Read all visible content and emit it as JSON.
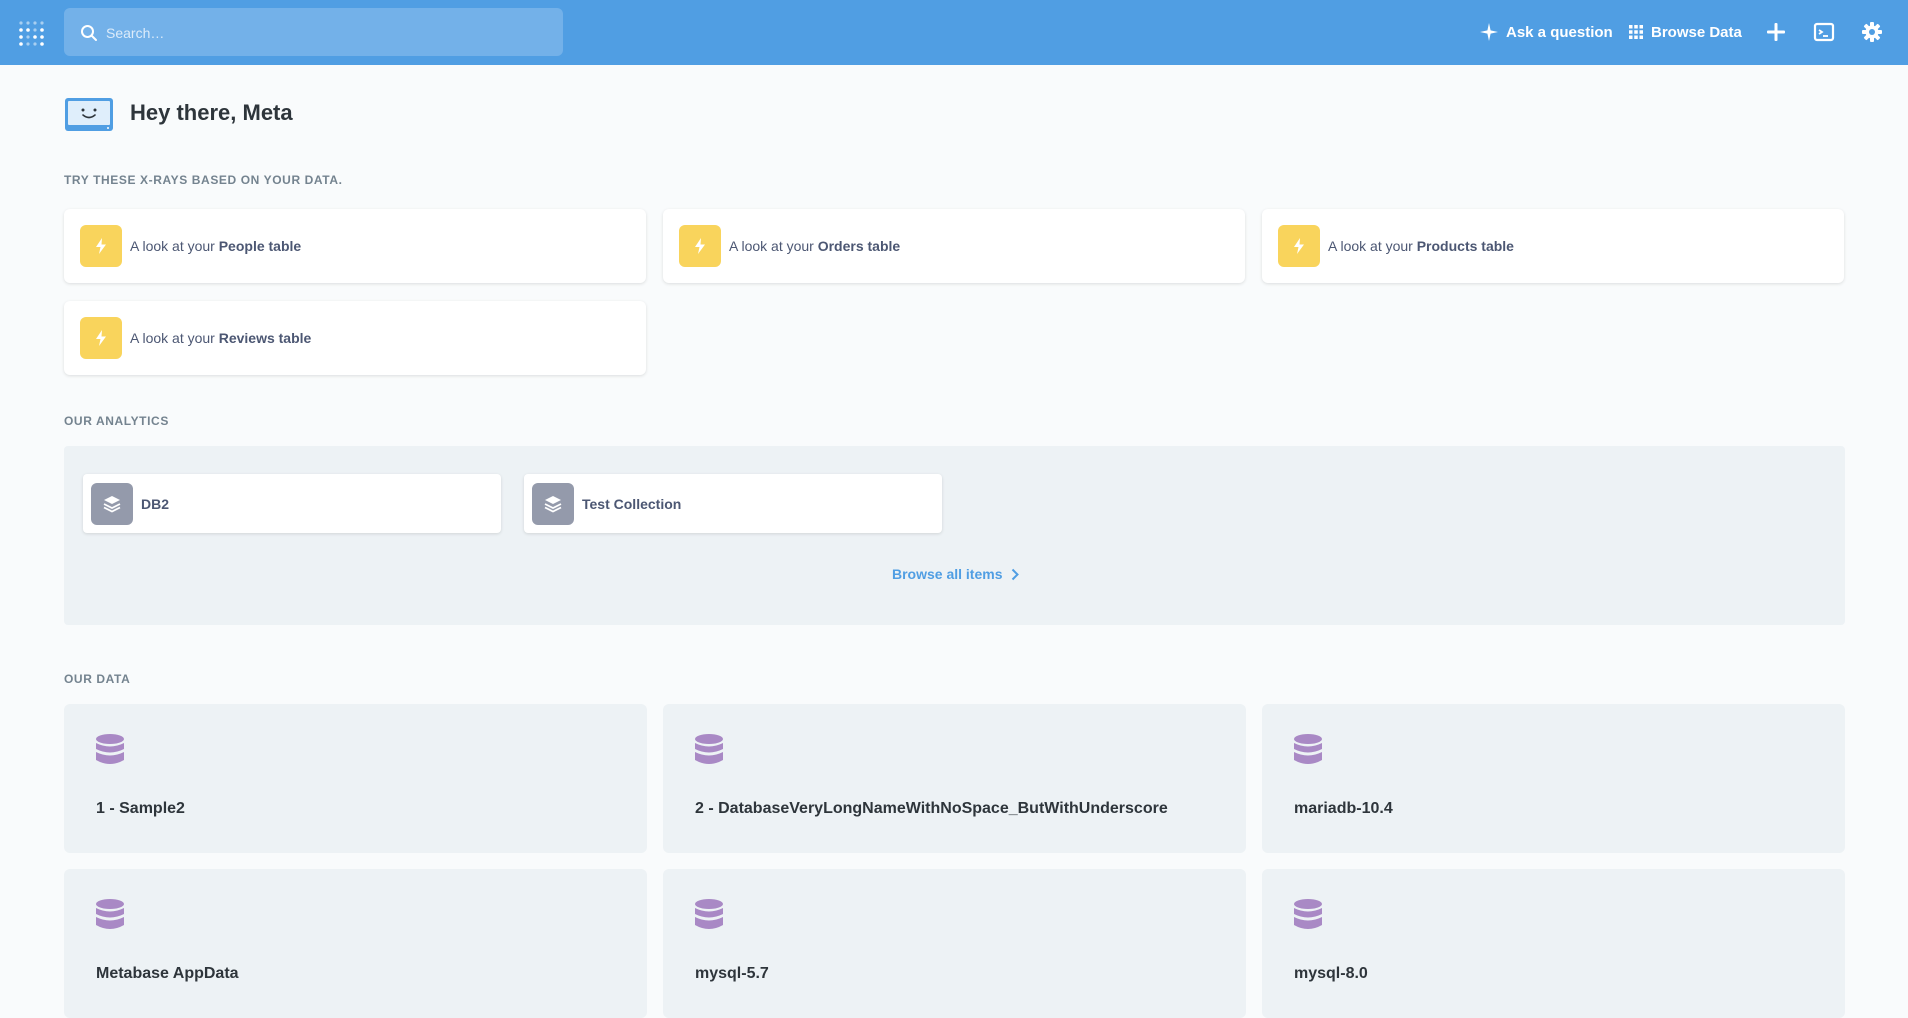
{
  "nav": {
    "search_placeholder": "Search…",
    "ask_question": "Ask a question",
    "browse_data": "Browse Data",
    "brand_color": "#509ee3"
  },
  "greeting": "Hey there, Meta",
  "xray_section_title": "TRY THESE X-RAYS BASED ON YOUR DATA.",
  "xrays": [
    {
      "prefix": "A look at your ",
      "table": "People table"
    },
    {
      "prefix": "A look at your ",
      "table": "Orders table"
    },
    {
      "prefix": "A look at your ",
      "table": "Products table"
    },
    {
      "prefix": "A look at your ",
      "table": "Reviews table"
    }
  ],
  "analytics_title": "OUR ANALYTICS",
  "collections": [
    {
      "name": "DB2"
    },
    {
      "name": "Test Collection"
    }
  ],
  "browse_all": "Browse all items",
  "data_title": "OUR DATA",
  "databases": [
    {
      "name": "1 - Sample2"
    },
    {
      "name": "2 - DatabaseVeryLongNameWithNoSpace_ButWithUnderscore"
    },
    {
      "name": "mariadb-10.4"
    },
    {
      "name": "Metabase AppData"
    },
    {
      "name": "mysql-5.7"
    },
    {
      "name": "mysql-8.0"
    }
  ],
  "colors": {
    "xray_icon_bg": "#f9d45c",
    "collection_icon_bg": "#949aab",
    "database_icon": "#a989c5"
  }
}
